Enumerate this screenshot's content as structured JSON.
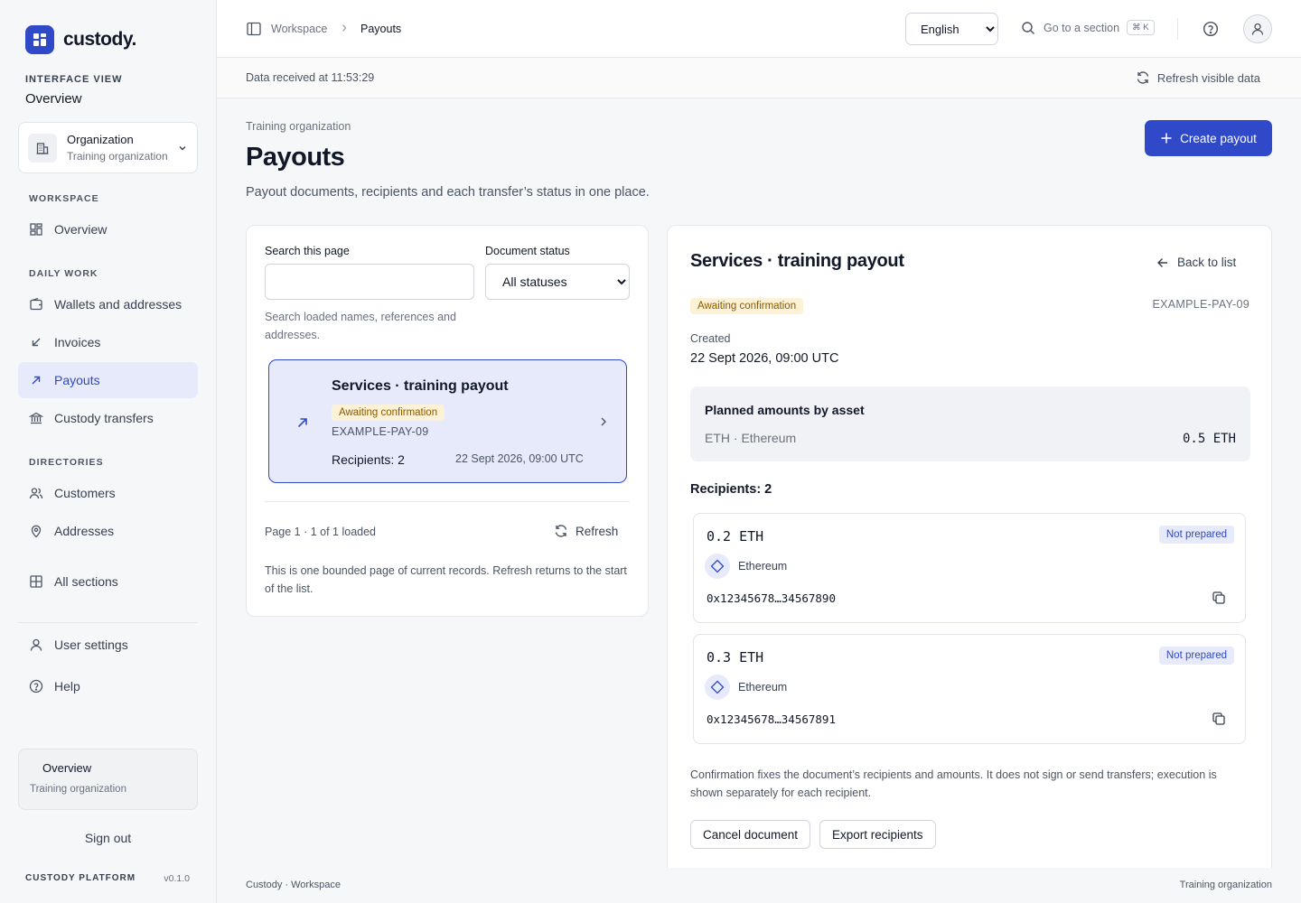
{
  "brand": {
    "name": "custody."
  },
  "sidebar": {
    "interface_view_label": "INTERFACE VIEW",
    "interface_view_value": "Overview",
    "org": {
      "title": "Organization",
      "subtitle": "Training organization"
    },
    "sections": {
      "workspace": "WORKSPACE",
      "daily_work": "DAILY WORK",
      "directories": "DIRECTORIES"
    },
    "items": {
      "overview": "Overview",
      "wallets": "Wallets and addresses",
      "invoices": "Invoices",
      "payouts": "Payouts",
      "custody_transfers": "Custody transfers",
      "customers": "Customers",
      "addresses": "Addresses",
      "all_sections": "All sections",
      "user_settings": "User settings",
      "help": "Help"
    },
    "context": {
      "title": "Overview",
      "subtitle": "Training organization"
    },
    "sign_out": "Sign out",
    "platform_label": "CUSTODY PLATFORM",
    "version": "v0.1.0"
  },
  "topbar": {
    "breadcrumb": [
      "Workspace",
      "Payouts"
    ],
    "language": {
      "selected": "English",
      "options": [
        "English"
      ]
    },
    "goto": {
      "label": "Go to a section",
      "shortcut": "⌘ K"
    }
  },
  "statusbar": {
    "received": "Data received at 11:53:29",
    "refresh_label": "Refresh visible data"
  },
  "page": {
    "eyebrow": "Training organization",
    "title": "Payouts",
    "description": "Payout documents, recipients and each transfer’s status in one place.",
    "create_label": "Create payout"
  },
  "list": {
    "search_label": "Search this page",
    "search_value": "",
    "search_help": "Search loaded names, references and addresses.",
    "status_label": "Document status",
    "status": {
      "selected": "All statuses",
      "options": [
        "All statuses"
      ]
    },
    "rows": [
      {
        "title": "Services · training payout",
        "status": "Awaiting confirmation",
        "ref": "EXAMPLE-PAY-09",
        "recipients": "Recipients: 2",
        "date": "22 Sept 2026, 09:00 UTC"
      }
    ],
    "page_info": "Page 1 · 1 of 1 loaded",
    "refresh_label": "Refresh",
    "note": "This is one bounded page of current records. Refresh returns to the start of the list."
  },
  "detail": {
    "title": "Services · training payout",
    "back_label": "Back to list",
    "status": "Awaiting confirmation",
    "ref": "EXAMPLE-PAY-09",
    "created_label": "Created",
    "created_value": "22 Sept 2026, 09:00 UTC",
    "planned": {
      "title": "Planned amounts by asset",
      "asset": "ETH · Ethereum",
      "amount": "0.5 ETH"
    },
    "recipients_heading": "Recipients: 2",
    "recipients": [
      {
        "amount": "0.2 ETH",
        "status": "Not prepared",
        "network": "Ethereum",
        "address": "0x12345678…34567890"
      },
      {
        "amount": "0.3 ETH",
        "status": "Not prepared",
        "network": "Ethereum",
        "address": "0x12345678…34567891"
      }
    ],
    "note": "Confirmation fixes the document’s recipients and amounts. It does not sign or send transfers; execution is shown separately for each recipient.",
    "cancel_label": "Cancel document",
    "export_label": "Export recipients"
  },
  "footer": {
    "left": "Custody · Workspace",
    "right": "Training organization"
  },
  "colors": {
    "accent": "#2f49c8",
    "accent_soft": "#e7eafb",
    "warning_bg": "#fdf1d6",
    "warning_text": "#8a5a00"
  }
}
